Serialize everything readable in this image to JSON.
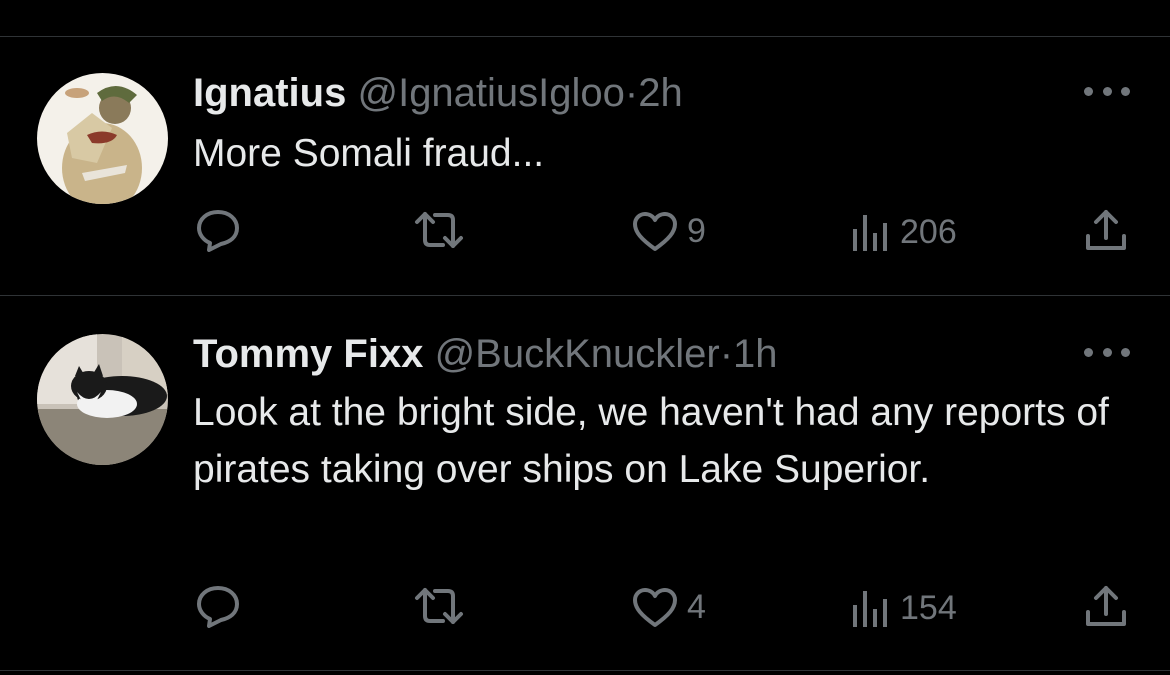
{
  "tweets": [
    {
      "display_name": "Ignatius",
      "handle": "@IgnatiusIgloo",
      "separator": "·",
      "time": "2h",
      "text": "More Somali fraud...",
      "likes": "9",
      "views": "206"
    },
    {
      "display_name": "Tommy Fixx",
      "handle": "@BuckKnuckler",
      "separator": "·",
      "time": "1h",
      "text": "Look at the bright side, we haven't had any reports of pirates taking over ships on Lake Superior.",
      "likes": "4",
      "views": "154"
    }
  ],
  "icons": {
    "reply": "reply-icon",
    "retweet": "retweet-icon",
    "like": "heart-icon",
    "views": "views-icon",
    "share": "share-icon",
    "more": "more-icon"
  },
  "colors": {
    "background": "#000000",
    "primary_text": "#e7e9ea",
    "secondary_text": "#71767b",
    "divider": "#2f3336"
  }
}
